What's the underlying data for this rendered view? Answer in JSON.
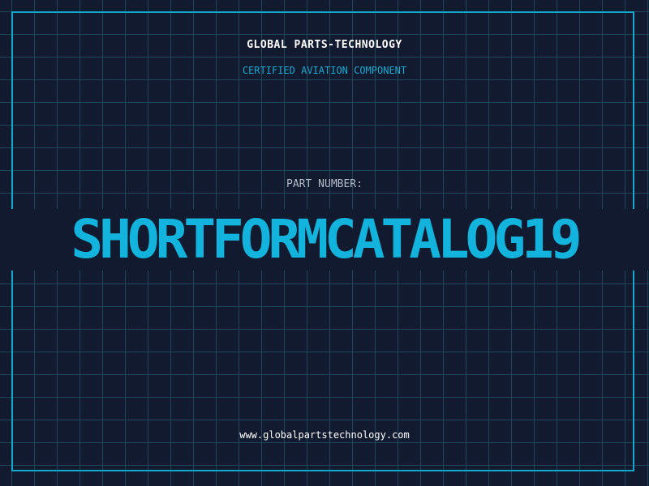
{
  "header": {
    "brand": "GLOBAL PARTS-TECHNOLOGY",
    "tagline": "CERTIFIED AVIATION COMPONENT"
  },
  "part": {
    "label": "PART NUMBER:",
    "number": "SHORTFORMCATALOG19"
  },
  "footer": {
    "website": "www.globalpartstechnology.com"
  },
  "colors": {
    "background": "#111a2e",
    "grid": "#1f4658",
    "accent": "#15a8cf",
    "text": "#ffffff"
  }
}
